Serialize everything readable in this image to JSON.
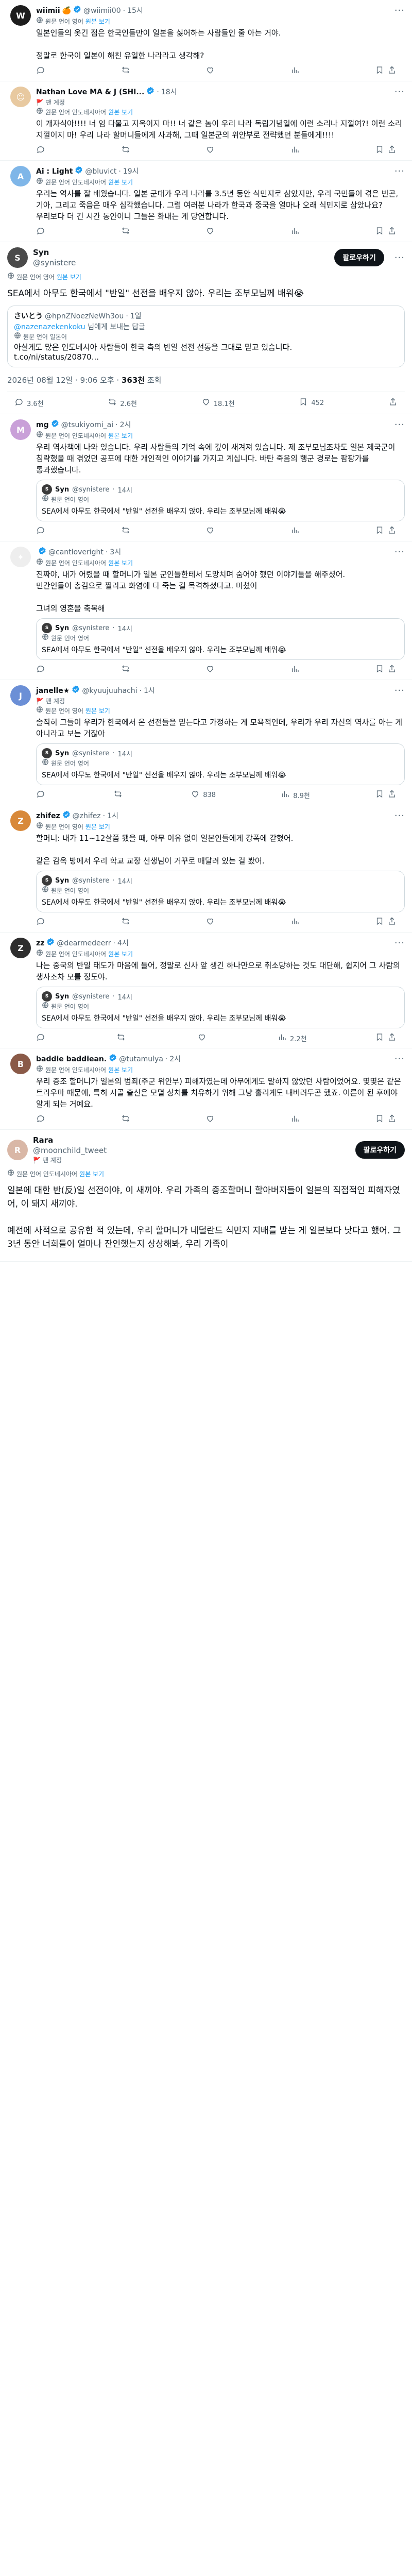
{
  "posts_top": [
    {
      "name": "wiimii",
      "badge": "🍊",
      "handle": "@wiimii00",
      "time": "15시",
      "lang": "원문 언어 영어",
      "view_original": "원본 보기",
      "text": "일본인들의 옷긴 점은 한국인들만이 일본을 싫어하는 사람들인 줄 아는 거야.\n\n정말로 한국이 일본이 해친 유일한 나라라고 생각해?",
      "avatar_color": "#1d1d1d",
      "avatar_text": "W"
    },
    {
      "name": "Nathan Love MA & J (SHI...",
      "handle": "",
      "time": "18시",
      "tag": "팬 계정",
      "lang": "원문 언어 인도네시아어",
      "view_original": "원본 보기",
      "text": "이 개자식아!!!! 너 임 다물고 지옥이지 마!! 너 같은 놈이 우리 나라 독립기념일에 이런 소리나 지껄여?! 이런 소리 지껄이지 마! 우리 나라 할머니들에게 사과해, 그때 일본군의 위안부로 전략했던 분들에게!!!!",
      "avatar_color": "#e8c9a0",
      "avatar_text": "😐"
    },
    {
      "name": "Ai : Light",
      "handle": "@bluvict",
      "time": "19시",
      "lang": "원문 언어 인도네시아어",
      "view_original": "원본 보기",
      "text": "우리는 역사를 잘 배웠습니다. 일본 군대가 우리 나라를 3.5년 동안 식민지로 삼았지만, 우리 국민들이 겪은 빈곤, 기아, 그리고 죽음은 매우 심각했습니다. 그럼 여러분 나라가 한국과 중국을 얼마나 오래 식민지로 삼았나요? 우리보다 더 긴 시간 동안이니 그들은 화내는 게 당연합니다.",
      "avatar_color": "#7fb6e8",
      "avatar_text": "A"
    }
  ],
  "main_post": {
    "name": "Syn",
    "handle": "@synistere",
    "lang": "원문 언어 영어",
    "view_original": "원본 보기",
    "follow_label": "팔로우하기",
    "text": "SEA에서 아무도 한국에서 \"반일\" 선전을 배우지 않아. 우리는 조부모님께 배워😭",
    "quote_name": "さいとう",
    "quote_handle": "@hpnZNoezNeWh3ou",
    "quote_time": "1일",
    "quote_reply_prefix": "@nazenazekenkoku",
    "quote_reply_suffix": "님에게 보내는 답글",
    "quote_lang": "원문 언어 일본어",
    "quote_text": "아실게도 많은 인도네시아 사람들이 한국 측의 반일 선전 선동을 그대로 믿고 있습니다.\nt.co/ni/status/20870...",
    "stat_date": "2026년 08월 12일 · 9:06 오후",
    "stat_views": "363천",
    "stat_views_label": "조회",
    "replies": "3.6천",
    "reposts": "2.6천",
    "likes": "18.1천",
    "bookmarks": "452",
    "avatar_color": "#4a4a4a",
    "avatar_text": "S"
  },
  "quote_snippet": {
    "name": "Syn",
    "handle": "@synistere",
    "time": "14시",
    "lang": "원문 언어 영어",
    "text": "SEA에서 아무도 한국에서 \"반일\" 선전을 배우지 않아. 우리는 조부모님께 배워😭"
  },
  "replies": [
    {
      "name": "mg",
      "handle": "@tsukiyomi_ai",
      "time": "2시",
      "lang": "원문 언어 인도네시아어",
      "view_original": "원본 보기",
      "text": "우리 역사책에 나와 있습니다. 우리 사람들의 기억 속에 깊이 새겨져 있습니다. 제 조부모님조차도 일본 제국군이 침략했을 때 겪었던 공포에 대한 개인적인 이야기를 가지고 계십니다. 바탄 죽음의 행군 경로는 팜팡가를 통과했습니다.",
      "avatar_color": "#c9a0d8",
      "avatar_text": "M",
      "has_quote": true,
      "replies": "",
      "reposts": "",
      "likes": "",
      "views": ""
    },
    {
      "name": "",
      "handle": "@cantloveright",
      "time": "3시",
      "lang": "원문 언어 인도네시아어",
      "view_original": "원본 보기",
      "text": "진짜야, 내가 어렸을 때 할머니가 일본 군인들한테서 도망치며 숨어야 했던 이야기들을 해주셨어.\n민간인들이 총검으로 찔리고 화염에 타 죽는 걸 목격하셨다고. 미쳤어\n\n그녀의 영혼을 축복해",
      "avatar_color": "#eeeeee",
      "avatar_text": "✦",
      "has_quote": true,
      "replies": "",
      "reposts": "",
      "likes": "",
      "views": ""
    },
    {
      "name": "janelle★",
      "handle": "@kyuujuuhachi",
      "time": "1시",
      "tag": "팬 계정",
      "lang": "원문 언어 영어",
      "view_original": "원본 보기",
      "text": "솔직히 그들이 우리가 한국에서 온 선전들을 믿는다고 가정하는 게 모욕적인데, 우리가 우리 자신의 역사를 아는 게 아니라고 보는 거잖아",
      "avatar_color": "#6b8fd6",
      "avatar_text": "J",
      "has_quote": true,
      "replies": "",
      "reposts": "",
      "likes": "838",
      "views": "8.9천"
    },
    {
      "name": "zhifez",
      "handle": "@zhifez",
      "time": "1시",
      "lang": "원문 언어 영어",
      "view_original": "원본 보기",
      "text": "할머니: 내가 11~12살쯤 됐을 때, 아무 이유 없이 일본인들에게 강폭에 갇혔어.\n\n같은 감옥 방에서 우리 학교 교장 선생님이 거꾸로 매달려 있는 걸 봤어.",
      "avatar_color": "#d8893a",
      "avatar_text": "Z",
      "has_quote": true,
      "replies": "",
      "reposts": "",
      "likes": "",
      "views": ""
    },
    {
      "name": "zz",
      "handle": "@dearmedeerr",
      "time": "4시",
      "lang": "원문 언어 인도네시아어",
      "view_original": "원본 보기",
      "text": "나는 중국의 반일 태도가 마음에 들어, 정말로 신사 앞 생긴 하나만으로 취소당하는 것도 대단해, 쉽지어 그 사람의 생사조차 모를 정도야.",
      "avatar_color": "#2e2e2e",
      "avatar_text": "Z",
      "has_quote": true,
      "replies": "",
      "reposts": "",
      "likes": "",
      "views": "2.2천"
    },
    {
      "name": "baddie baddiean.",
      "handle": "@tutamulya",
      "time": "2시",
      "lang": "원문 언어 인도네시아어",
      "view_original": "원본 보기",
      "text": "우리 증조 할머니가 일본의 범죄(주군 위안부) 피해자였는데 아무에게도 말하지 않았던 사람이었어요. 몇몇은 같은 트라우마 때문에, 특히 시골 출신은 모멸 상처를 치유하기 위해 그냥 홀리게도 내버려두곤 했죠. 어른이 된 후에야 알게 되는 거예요.",
      "avatar_color": "#8a5a48",
      "avatar_text": "B",
      "has_quote": false,
      "replies": "",
      "reposts": "",
      "likes": "",
      "views": ""
    }
  ],
  "last_post": {
    "name": "Rara",
    "handle": "@moonchild_tweet",
    "tag": "팬 계정",
    "lang": "원문 언어 인도네시아어",
    "view_original": "원본 보기",
    "follow_label": "팔로우하기",
    "text": "일본에 대한 반(反)일 선전이야, 이 새끼야. 우리 가족의 증조할머니 할아버지들이 일본의 직접적인 피해자였어, 이 돼지 새끼야.\n\n예전에 사적으로 공유한 적 있는데, 우리 할머니가 네덜란드 식민지 지배를 받는 게 일본보다 낫다고 했어. 그 3년 동안 너희들이 얼마나 잔인했는지 상상해봐, 우리 가족이",
    "avatar_color": "#d9b7a6",
    "avatar_text": "R"
  },
  "colors": {
    "accent": "#1d9bf0",
    "muted": "#536471",
    "verified": "#1d9bf0"
  }
}
